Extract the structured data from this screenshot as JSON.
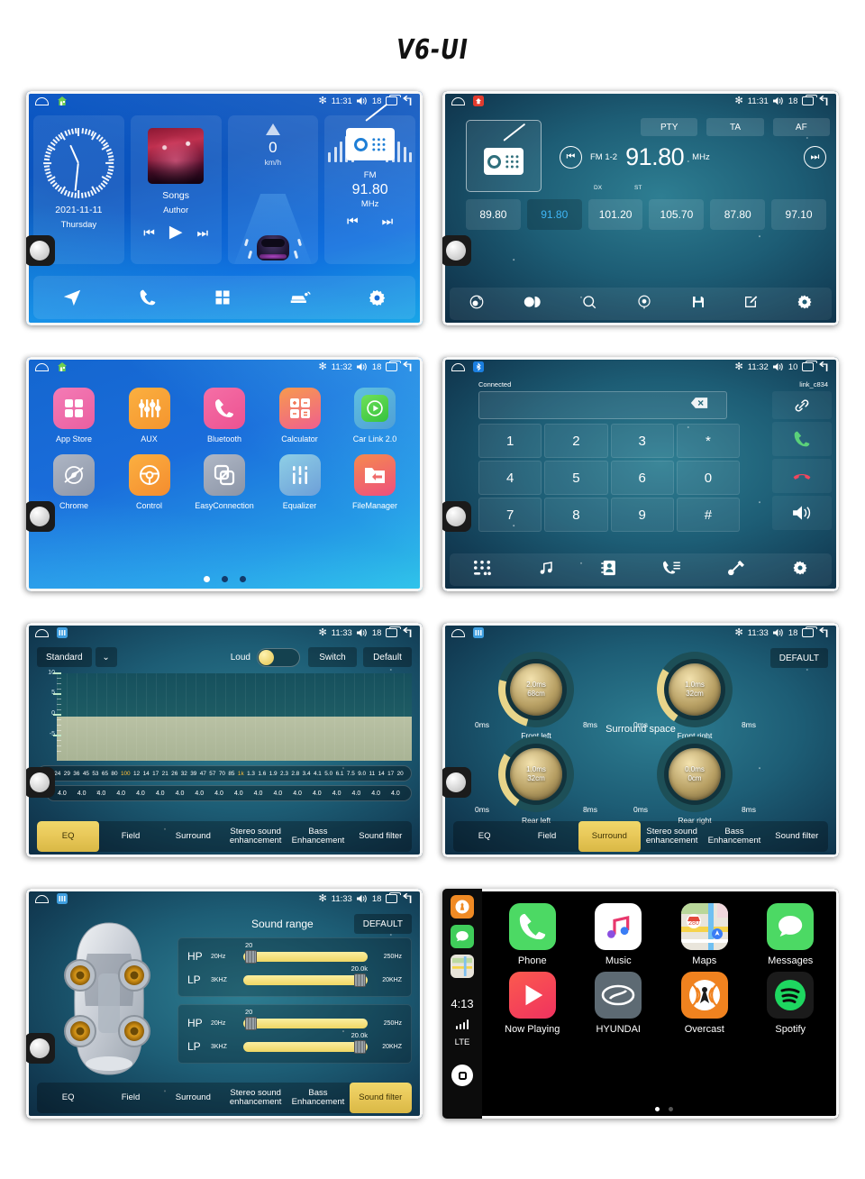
{
  "title": "V6-UI",
  "statusbar": {
    "home_icon": "home-outline-icon",
    "app_icon": "app-shortcut-icon",
    "bluetooth_icon": "bluetooth-icon",
    "volume_icon": "volume-icon",
    "recent_icon": "recent-apps-icon",
    "back_icon": "back-arrow-icon"
  },
  "screens": {
    "home": {
      "time": "11:31",
      "volume": "18",
      "clock_widget": {
        "date": "2021-11-11",
        "weekday": "Thursday"
      },
      "music_widget": {
        "title": "Songs",
        "artist": "Author"
      },
      "speed_widget": {
        "value": "0",
        "unit": "km/h"
      },
      "radio_widget": {
        "band": "FM",
        "frequency": "91.80",
        "unit": "MHz"
      },
      "dock": [
        {
          "name": "navigation-icon"
        },
        {
          "name": "phone-icon"
        },
        {
          "name": "apps-icon"
        },
        {
          "name": "car-link-icon"
        },
        {
          "name": "settings-icon"
        }
      ]
    },
    "radio": {
      "time": "11:31",
      "volume": "18",
      "rds_buttons": [
        "PTY",
        "TA",
        "AF"
      ],
      "band": "FM 1-2",
      "frequency": "91.80",
      "unit": "MHz",
      "dx_label": "DX",
      "st_label": "ST",
      "presets": [
        "89.80",
        "91.80",
        "101.20",
        "105.70",
        "87.80",
        "97.10"
      ],
      "active_preset_index": 1,
      "toolbar": [
        {
          "name": "band-icon"
        },
        {
          "name": "stereo-toggle-icon"
        },
        {
          "name": "scan-search-icon"
        },
        {
          "name": "rds-icon"
        },
        {
          "name": "save-icon"
        },
        {
          "name": "edit-icon"
        },
        {
          "name": "settings-icon"
        }
      ]
    },
    "apps": {
      "time": "11:32",
      "volume": "18",
      "row1": [
        {
          "label": "App Store",
          "icon": "grid-apps-icon",
          "color": "#f06ba8"
        },
        {
          "label": "AUX",
          "icon": "sliders-icon",
          "color": "#f7a13a"
        },
        {
          "label": "Bluetooth",
          "icon": "phone-icon",
          "color": "#f0649f"
        },
        {
          "label": "Calculator",
          "icon": "calculator-icon",
          "color": "#f4874f"
        },
        {
          "label": "Car Link 2.0",
          "icon": "play-circle-icon",
          "color": "#4aa8d8"
        }
      ],
      "row2": [
        {
          "label": "Chrome",
          "icon": "compass-icon",
          "color": "#9aa3b4"
        },
        {
          "label": "Control",
          "icon": "steering-wheel-icon",
          "color": "#f6a03c"
        },
        {
          "label": "EasyConnection",
          "icon": "screen-mirror-icon",
          "color": "#9aa3b4"
        },
        {
          "label": "Equalizer",
          "icon": "equalizer-icon",
          "color": "#6fb6d6"
        },
        {
          "label": "FileManager",
          "icon": "folder-icon",
          "color": "#f0577d"
        }
      ],
      "page_dots": 3,
      "active_page": 0
    },
    "bluetooth": {
      "time": "11:32",
      "volume": "10",
      "connection_status": "Connected",
      "device_name": "link_c834",
      "dial_value": "",
      "backspace_icon": "backspace-icon",
      "keys": [
        "1",
        "2",
        "3",
        "*",
        "4",
        "5",
        "6",
        "0",
        "7",
        "8",
        "9",
        "#"
      ],
      "call_buttons": [
        {
          "name": "link-icon"
        },
        {
          "name": "call-answer-icon"
        },
        {
          "name": "call-end-icon"
        },
        {
          "name": "speaker-icon"
        }
      ],
      "toolbar": [
        {
          "name": "dialpad-icon"
        },
        {
          "name": "music-icon"
        },
        {
          "name": "contacts-icon"
        },
        {
          "name": "call-history-icon"
        },
        {
          "name": "bluetooth-connect-icon"
        },
        {
          "name": "settings-icon"
        }
      ]
    },
    "equalizer": {
      "time": "11:33",
      "volume": "18",
      "preset": "Standard",
      "dropdown_icon": "chevron-down-icon",
      "loud_label": "Loud",
      "loud_on": true,
      "switch_label": "Switch",
      "default_label": "Default",
      "y_axis": [
        "10",
        "5",
        "0",
        "-5"
      ],
      "frequencies": [
        "20",
        "24",
        "29",
        "36",
        "45",
        "53",
        "65",
        "80",
        "100",
        "12",
        "14",
        "17",
        "21",
        "26",
        "32",
        "39",
        "47",
        "57",
        "70",
        "85",
        "1k",
        "1.3",
        "1.6",
        "1.9",
        "2.3",
        "2.8",
        "3.4",
        "4.1",
        "5.0",
        "6.1",
        "7.5",
        "9.0",
        "11",
        "14",
        "17",
        "20"
      ],
      "highlighted_frequencies": [
        "100",
        "1k"
      ],
      "q_label": "Q:",
      "q_values": [
        "4.0",
        "4.0",
        "4.0",
        "4.0",
        "4.0",
        "4.0",
        "4.0",
        "4.0",
        "4.0",
        "4.0",
        "4.0",
        "4.0",
        "4.0",
        "4.0",
        "4.0",
        "4.0",
        "4.0",
        "4.0"
      ],
      "tabs": [
        "EQ",
        "Field",
        "Surround",
        "Stereo sound enhancement",
        "Bass Enhancement",
        "Sound filter"
      ],
      "active_tab": 0
    },
    "surround": {
      "time": "11:33",
      "volume": "18",
      "default_label": "DEFAULT",
      "title": "Surround space",
      "knobs": [
        {
          "label": "Front left",
          "delay": "2.0ms",
          "distance": "68cm",
          "min": "0ms",
          "max": "8ms"
        },
        {
          "label": "Front right",
          "delay": "1.0ms",
          "distance": "32cm",
          "min": "0ms",
          "max": "8ms"
        },
        {
          "label": "Rear left",
          "delay": "1.0ms",
          "distance": "32cm",
          "min": "0ms",
          "max": "8ms"
        },
        {
          "label": "Rear right",
          "delay": "0.0ms",
          "distance": "0cm",
          "min": "0ms",
          "max": "8ms"
        }
      ],
      "tabs": [
        "EQ",
        "Field",
        "Surround",
        "Stereo sound enhancement",
        "Bass Enhancement",
        "Sound filter"
      ],
      "active_tab": 2
    },
    "soundfilter": {
      "time": "11:33",
      "volume": "18",
      "title": "Sound range",
      "default_label": "DEFAULT",
      "groups": [
        {
          "rows": [
            {
              "name": "HP",
              "min": "20Hz",
              "max": "250Hz",
              "value": "20"
            },
            {
              "name": "LP",
              "min": "3KHZ",
              "max": "20KHZ",
              "value": "20.0k"
            }
          ]
        },
        {
          "rows": [
            {
              "name": "HP",
              "min": "20Hz",
              "max": "250Hz",
              "value": "20"
            },
            {
              "name": "LP",
              "min": "3KHZ",
              "max": "20KHZ",
              "value": "20.0k"
            }
          ]
        }
      ],
      "tabs": [
        "EQ",
        "Field",
        "Surround",
        "Stereo sound enhancement",
        "Bass Enhancement",
        "Sound filter"
      ],
      "active_tab": 5
    },
    "carplay": {
      "time": "4:13",
      "network": "LTE",
      "sidebar_icons": [
        "overcast-icon",
        "messages-icon",
        "maps-icon"
      ],
      "home_icon": "carplay-home-icon",
      "row1": [
        {
          "label": "Phone",
          "icon": "phone-icon"
        },
        {
          "label": "Music",
          "icon": "music-note-icon"
        },
        {
          "label": "Maps",
          "icon": "maps-icon"
        },
        {
          "label": "Messages",
          "icon": "messages-icon"
        }
      ],
      "row2": [
        {
          "label": "Now Playing",
          "icon": "play-icon"
        },
        {
          "label": "HYUNDAI",
          "icon": "hyundai-icon"
        },
        {
          "label": "Overcast",
          "icon": "overcast-icon"
        },
        {
          "label": "Spotify",
          "icon": "spotify-icon"
        }
      ],
      "page_dots": 2,
      "active_page": 0
    }
  }
}
